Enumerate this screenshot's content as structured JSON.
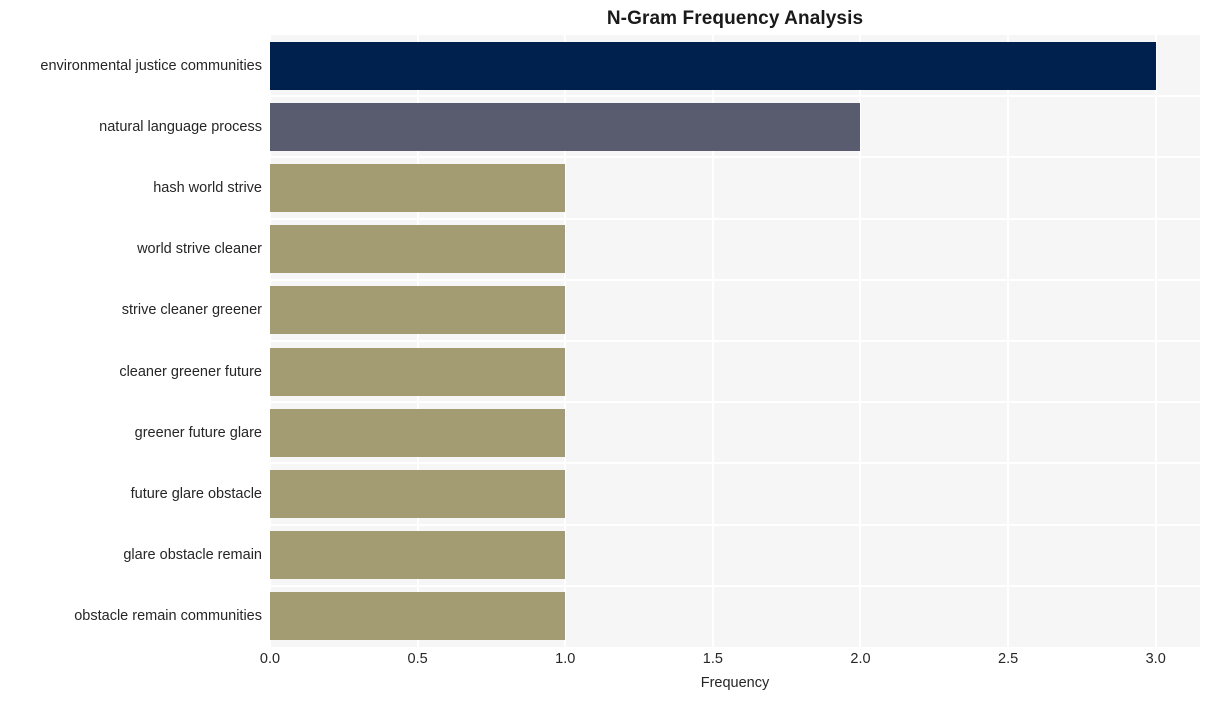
{
  "chart_data": {
    "type": "bar",
    "orientation": "horizontal",
    "title": "N-Gram Frequency Analysis",
    "xlabel": "Frequency",
    "ylabel": "",
    "xlim": [
      0,
      3.15
    ],
    "ylim": [
      0,
      10
    ],
    "grid": true,
    "legend": false,
    "xticks": [
      "0.0",
      "0.5",
      "1.0",
      "1.5",
      "2.0",
      "2.5",
      "3.0"
    ],
    "xtick_values": [
      0.0,
      0.5,
      1.0,
      1.5,
      2.0,
      2.5,
      3.0
    ],
    "categories": [
      "environmental justice communities",
      "natural language process",
      "hash world strive",
      "world strive cleaner",
      "strive cleaner greener",
      "cleaner greener future",
      "greener future glare",
      "future glare obstacle",
      "glare obstacle remain",
      "obstacle remain communities"
    ],
    "values": [
      3,
      2,
      1,
      1,
      1,
      1,
      1,
      1,
      1,
      1
    ],
    "bar_colors": [
      "#00214d",
      "#585c6e",
      "#a39b72",
      "#a39b72",
      "#a39b72",
      "#a39b72",
      "#a39b72",
      "#a39b72",
      "#a39b72",
      "#a39b72"
    ]
  },
  "style": {
    "figure_background": "#ffffff",
    "plot_background": "#f6f6f7",
    "gridline_color": "#ffffff",
    "text_color": "#262626",
    "title_color": "#1a1a1a"
  }
}
